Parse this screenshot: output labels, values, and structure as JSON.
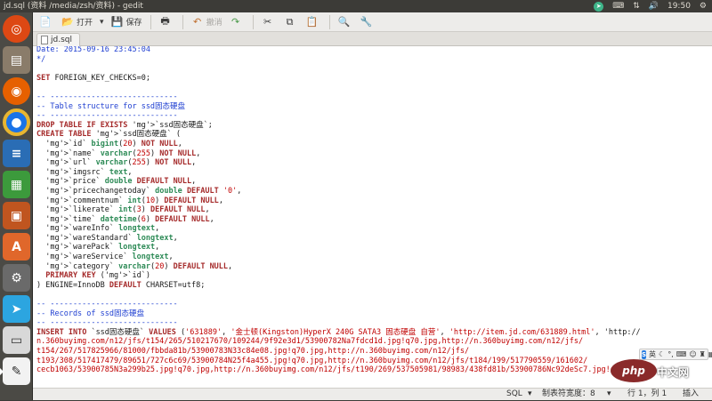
{
  "window": {
    "title": "jd.sql (资料 /media/zsh/资料) - gedit"
  },
  "panel": {
    "time": "19:50"
  },
  "toolbar": {
    "open_label": "打开",
    "save_label": "保存",
    "undo_label": "撤消"
  },
  "tab": {
    "label": "jd.sql"
  },
  "editor": {
    "lines": [
      "Date: 2015-09-16 23:45:04",
      "*/",
      "",
      "SET FOREIGN_KEY_CHECKS=0;",
      "",
      "-- ----------------------------",
      "-- Table structure for ssd固态硬盘",
      "-- ----------------------------",
      "DROP TABLE IF EXISTS `ssd固态硬盘`;",
      "CREATE TABLE `ssd固态硬盘` (",
      "  `id` bigint(20) NOT NULL,",
      "  `name` varchar(255) NOT NULL,",
      "  `url` varchar(255) NOT NULL,",
      "  `imgsrc` text,",
      "  `price` double DEFAULT NULL,",
      "  `pricechangetoday` double DEFAULT '0',",
      "  `commentnum` int(10) DEFAULT NULL,",
      "  `likerate` int(3) DEFAULT NULL,",
      "  `time` datetime(6) DEFAULT NULL,",
      "  `wareInfo` longtext,",
      "  `wareStandard` longtext,",
      "  `warePack` longtext,",
      "  `wareService` longtext,",
      "  `category` varchar(20) DEFAULT NULL,",
      "  PRIMARY KEY (`id`)",
      ") ENGINE=InnoDB DEFAULT CHARSET=utf8;",
      "",
      "-- ----------------------------",
      "-- Records of ssd固态硬盘",
      "-- ----------------------------",
      "INSERT INTO `ssd固态硬盘` VALUES ('631889', '金士顿(Kingston)HyperX 240G SATA3 固态硬盘 自营', 'http://item.jd.com/631889.html', 'http://",
      "n.360buyimg.com/n12/jfs/t154/265/510217670/109244/9f92e3d1/53900782Na7fdcd1d.jpg!q70.jpg,http://n.360buyimg.com/n12/jfs/",
      "t154/267/517825966/81000/fbbda81b/53900783N33c84e08.jpg!q70.jpg,http://n.360buyimg.com/n12/jfs/",
      "t193/308/517417479/89651/727c6c69/53900784N25f4a455.jpg!q70.jpg,http://n.360buyimg.com/n12/jfs/t184/199/517790559/161602/",
      "cecb1063/53900785N3a299b25.jpg!q70.jpg,http://n.360buyimg.com/n12/jfs/t190/269/537505981/98983/438fd81b/53900786Nc92deSc7.jpg!q70"
    ]
  },
  "statusbar": {
    "language": "SQL",
    "tab_width": "制表符宽度：8",
    "position": "行 1，列 1",
    "insert_mode": "插入"
  },
  "overlay": {
    "ime_label": "英",
    "php_logo": "php",
    "site_name": "中文网"
  }
}
